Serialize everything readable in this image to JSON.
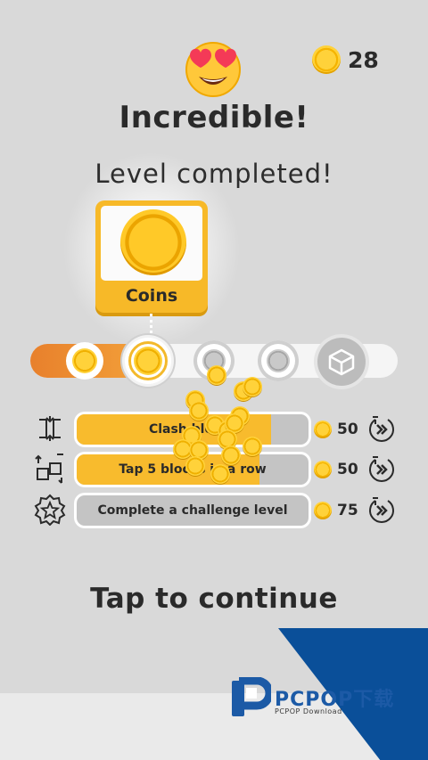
{
  "header": {
    "emoji": "heart-eyes-emoji",
    "coin_count": "28",
    "headline": "Incredible!",
    "subline": "Level completed!"
  },
  "reward_card": {
    "icon": "coin-icon",
    "label": "Coins"
  },
  "level_progress": {
    "fill_fraction": 0.33,
    "nodes": [
      {
        "type": "coin",
        "state": "collected"
      },
      {
        "type": "coin",
        "state": "current"
      },
      {
        "type": "coin",
        "state": "locked"
      },
      {
        "type": "coin",
        "state": "locked"
      },
      {
        "type": "box",
        "state": "locked"
      }
    ]
  },
  "goals": [
    {
      "icon": "clash-icon",
      "label": "Clash blocks",
      "progress": 0.84,
      "reward": "50",
      "action_icon": "skip-ad-icon"
    },
    {
      "icon": "blocks-row-icon",
      "label": "Tap 5 blocks in a row",
      "progress": 0.79,
      "reward": "50",
      "action_icon": "skip-ad-icon"
    },
    {
      "icon": "star-badge-icon",
      "label": "Complete a challenge level",
      "progress": 0.0,
      "reward": "75",
      "action_icon": "skip-ad-icon"
    }
  ],
  "footer": {
    "tap_continue": "Tap to continue"
  },
  "watermark": {
    "brand": "PCPOP下载",
    "sub": "PCPOP Download"
  },
  "colors": {
    "background": "#d9d9d9",
    "accent_yellow": "#f8bb2d",
    "progress_orange": "#e8802c",
    "watermark_blue": "#0a4f99"
  }
}
